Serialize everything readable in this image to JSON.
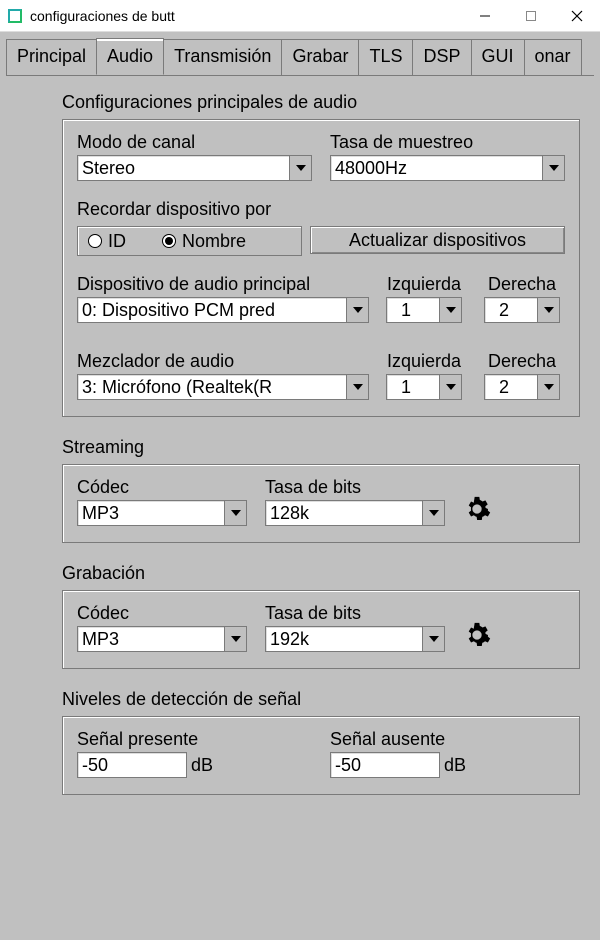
{
  "window": {
    "title": "configuraciones de butt"
  },
  "tabs": {
    "principal": "Principal",
    "audio": "Audio",
    "transmision": "Transmisión",
    "grabar": "Grabar",
    "tls": "TLS",
    "dsp": "DSP",
    "gui": "GUI",
    "onar": "onar"
  },
  "main_audio": {
    "title": "Configuraciones principales de audio",
    "channel_mode_label": "Modo de canal",
    "channel_mode_value": "Stereo",
    "sample_rate_label": "Tasa de muestreo",
    "sample_rate_value": "48000Hz",
    "remember_label": "Recordar dispositivo por",
    "remember_id": "ID",
    "remember_name": "Nombre",
    "update_devices_btn": "Actualizar dispositivos",
    "primary_device_label": "Dispositivo de audio principal",
    "primary_device_value": "0: Dispositivo PCM pred",
    "left_label": "Izquierda",
    "right_label": "Derecha",
    "primary_left": "1",
    "primary_right": "2",
    "mixer_label": "Mezclador de audio",
    "mixer_value": "3: Micrófono (Realtek(R",
    "mixer_left": "1",
    "mixer_right": "2"
  },
  "streaming": {
    "title": "Streaming",
    "codec_label": "Códec",
    "codec_value": "MP3",
    "bitrate_label": "Tasa de bits",
    "bitrate_value": "128k"
  },
  "recording": {
    "title": "Grabación",
    "codec_label": "Códec",
    "codec_value": "MP3",
    "bitrate_label": "Tasa de bits",
    "bitrate_value": "192k"
  },
  "signal": {
    "title": "Niveles de detección de señal",
    "present_label": "Señal presente",
    "present_value": "-50",
    "absent_label": "Señal ausente",
    "absent_value": "-50",
    "db_unit": "dB"
  }
}
